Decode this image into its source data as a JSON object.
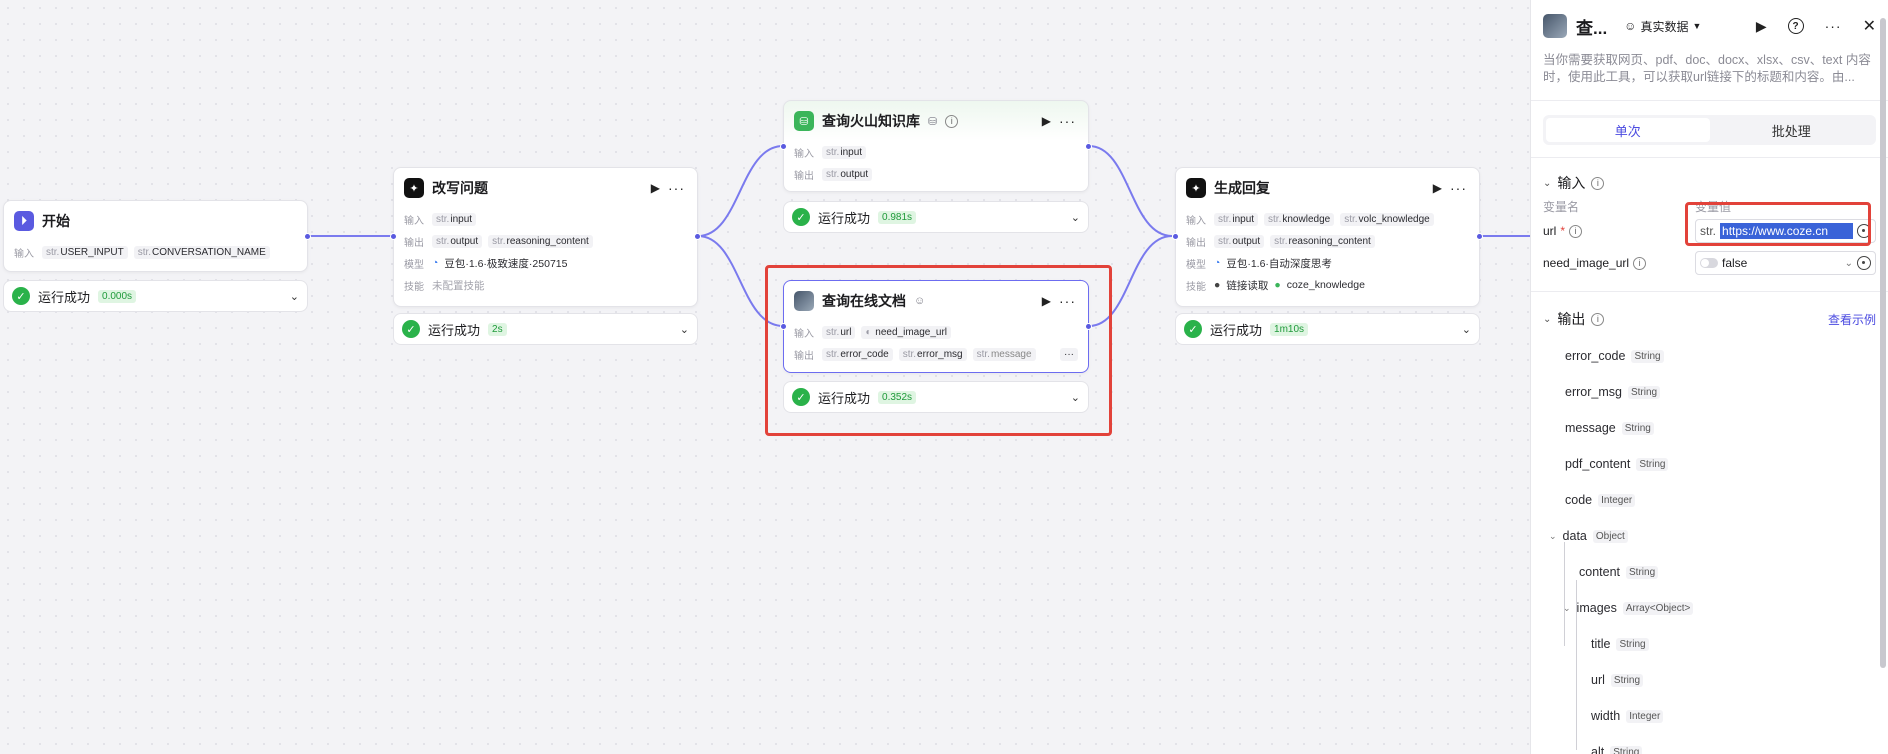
{
  "nodes": {
    "start": {
      "title": "开始",
      "input_label": "输入",
      "in1": "USER_INPUT",
      "in2": "CONVERSATION_NAME",
      "status": "运行成功",
      "time": "0.000s"
    },
    "rewrite": {
      "title": "改写问题",
      "input_label": "输入",
      "output_label": "输出",
      "model_label": "模型",
      "skill_label": "技能",
      "in1": "input",
      "out1": "output",
      "out2": "reasoning_content",
      "model": "豆包·1.6·极致速度·250715",
      "skill": "未配置技能",
      "status": "运行成功",
      "time": "2s"
    },
    "kb": {
      "title": "查询火山知识库",
      "input_label": "输入",
      "output_label": "输出",
      "in1": "input",
      "out1": "output",
      "status": "运行成功",
      "time": "0.981s"
    },
    "doc": {
      "title": "查询在线文档",
      "input_label": "输入",
      "output_label": "输出",
      "in1": "url",
      "in2": "need_image_url",
      "out1": "error_code",
      "out2": "error_msg",
      "out3": "message",
      "status": "运行成功",
      "time": "0.352s"
    },
    "reply": {
      "title": "生成回复",
      "input_label": "输入",
      "output_label": "输出",
      "model_label": "模型",
      "skill_label": "技能",
      "in1": "input",
      "in2": "knowledge",
      "in3": "volc_knowledge",
      "out1": "output",
      "out2": "reasoning_content",
      "model": "豆包·1.6·自动深度思考",
      "skill1": "链接读取",
      "skill2": "coze_knowledge",
      "status": "运行成功",
      "time": "1m10s"
    }
  },
  "str_prefix": "str.",
  "panel": {
    "title": "查...",
    "mode": "真实数据",
    "description": "当你需要获取网页、pdf、doc、docx、xlsx、csv、text 内容时，使用此工具，可以获取url链接下的标题和内容。由...",
    "tabs": [
      "单次",
      "批处理"
    ],
    "input_section": "输入",
    "col_name": "变量名",
    "col_value": "变量值",
    "params": [
      {
        "name": "url",
        "required": "*",
        "prefix": "str.",
        "value": "https://www.coze.cn"
      },
      {
        "name": "need_image_url",
        "value": "false"
      }
    ],
    "output_section": "输出",
    "view_example": "查看示例",
    "outputs": [
      {
        "name": "error_code",
        "type": "String"
      },
      {
        "name": "error_msg",
        "type": "String"
      },
      {
        "name": "message",
        "type": "String"
      },
      {
        "name": "pdf_content",
        "type": "String"
      },
      {
        "name": "code",
        "type": "Integer"
      },
      {
        "name": "data",
        "type": "Object"
      },
      {
        "name": "content",
        "type": "String"
      },
      {
        "name": "images",
        "type": "Array<Object>"
      },
      {
        "name": "title",
        "type": "String"
      },
      {
        "name": "url",
        "type": "String"
      },
      {
        "name": "width",
        "type": "Integer"
      },
      {
        "name": "alt",
        "type": "String"
      }
    ]
  },
  "colors": {
    "accent": "#4b4be0",
    "edge": "#6c6cf0",
    "success": "#2ab24a",
    "highlight": "#e2423a"
  }
}
